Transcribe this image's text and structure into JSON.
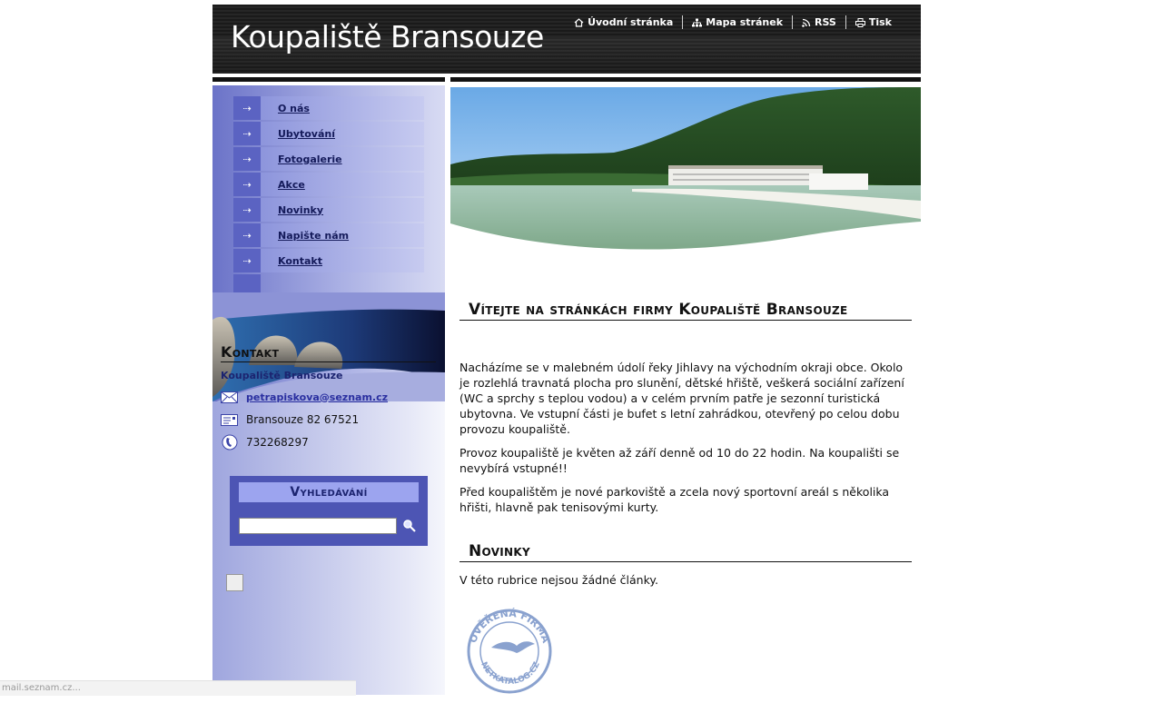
{
  "site": {
    "title": "Koupaliště Bransouze"
  },
  "top_nav": [
    {
      "label": "Úvodní stránka",
      "icon": "home-icon"
    },
    {
      "label": "Mapa stránek",
      "icon": "sitemap-icon"
    },
    {
      "label": "RSS",
      "icon": "rss-icon"
    },
    {
      "label": "Tisk",
      "icon": "print-icon"
    }
  ],
  "menu": [
    {
      "label": "O nás"
    },
    {
      "label": "Ubytování"
    },
    {
      "label": "Fotogalerie"
    },
    {
      "label": "Akce"
    },
    {
      "label": "Novinky"
    },
    {
      "label": "Napište nám"
    },
    {
      "label": "Kontakt"
    }
  ],
  "kontakt": {
    "title": "Kontakt",
    "company": "Koupaliště Bransouze",
    "email": "petrapiskova@seznam.cz",
    "address": "Bransouze 82 67521",
    "phone": "732268297"
  },
  "search": {
    "title": "Vyhledávání",
    "placeholder": ""
  },
  "content": {
    "welcome_title": "Vítejte na stránkách firmy Koupaliště Bransouze",
    "paragraphs": [
      "Nacházíme se v malebném údolí řeky Jihlavy na východním okraji obce.  Okolo je rozlehlá travnatá plocha pro slunění, dětské hřiště, veškerá sociální zařízení (WC a sprchy s teplou vodou) a v celém prvním patře je sezonní turistická ubytovna. Ve vstupní části je bufet s letní zahrádkou, otevřený po celou dobu provozu koupaliště.",
      "Provoz koupaliště je květen až září denně od 10 do 22 hodin. Na koupališti se nevybírá vstupné!!",
      "Před koupalištěm je nové parkoviště a zcela nový sportovní areál s několika hřišti, hlavně pak tenisovými kurty."
    ],
    "news_title": "Novinky",
    "news_empty": "V této rubrice nejsou žádné články."
  },
  "stamp": {
    "text_top": "OVĚŘENÁ FIRMA",
    "text_bottom": "NETKATALOG.CZ"
  },
  "status_bar": {
    "text": "mail.seznam.cz..."
  },
  "colors": {
    "header_bg": "#1a1a1a",
    "sidebar_accent": "#5b63c2",
    "link": "#2a2fa0",
    "search_bg": "#4d55b4"
  }
}
